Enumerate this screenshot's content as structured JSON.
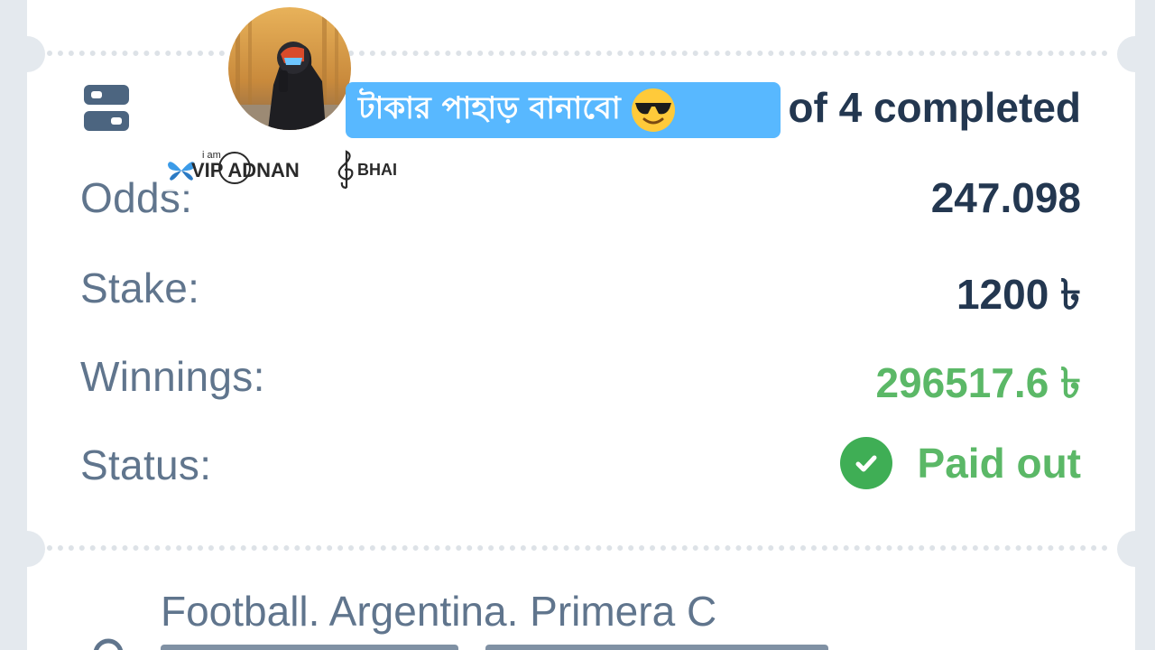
{
  "overlay": {
    "banner_text": "টাকার পাহাড় বানাবো",
    "banner_emoji": "sunglasses-emoji",
    "watermark": {
      "prefix_small": "i am",
      "name": "VIP ADNAN",
      "suffix": "BHAI"
    },
    "avatar": "profile-photo-helmet-rider"
  },
  "bet": {
    "progress_text": "of 4 completed",
    "rows": [
      {
        "label": "Odds:",
        "value": "247.098"
      },
      {
        "label": "Stake:",
        "value": "1200 ৳"
      },
      {
        "label": "Winnings:",
        "value": "296517.6 ৳"
      }
    ],
    "status": {
      "label": "Status:",
      "value": "Paid out",
      "icon": "check-circle-icon"
    }
  },
  "event": {
    "league": "Football. Argentina. Primera C"
  },
  "colors": {
    "background": "#e4e9ee",
    "card": "#ffffff",
    "label": "#60758d",
    "value": "#233750",
    "win": "#5bb867",
    "banner": "#58b8ff"
  }
}
